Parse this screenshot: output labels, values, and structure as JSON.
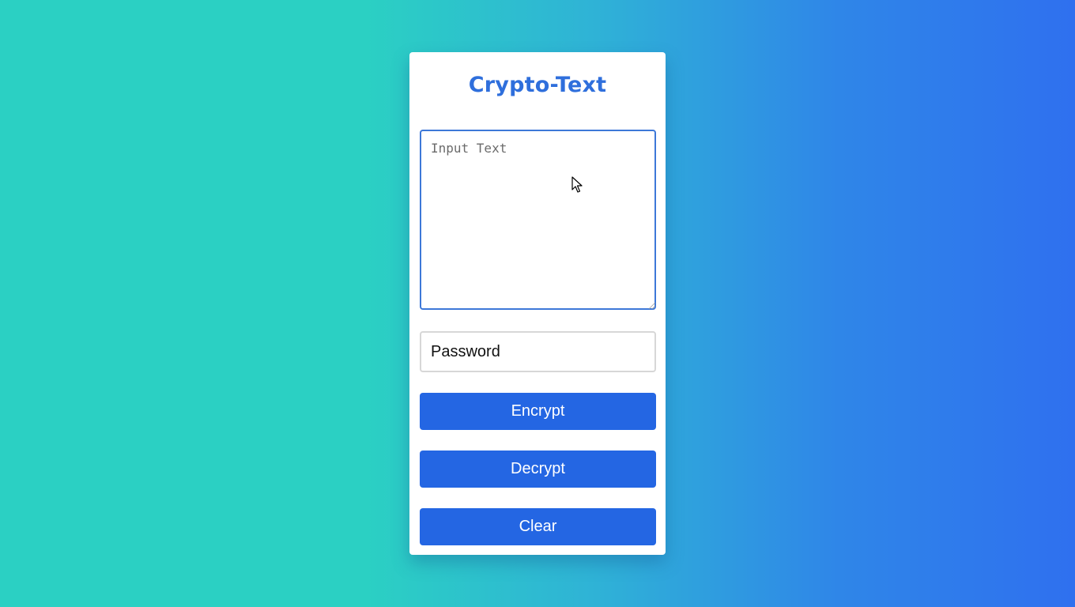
{
  "app": {
    "title": "Crypto-Text"
  },
  "text_input": {
    "placeholder": "Input Text",
    "value": ""
  },
  "password_input": {
    "placeholder": "Password",
    "value": ""
  },
  "buttons": {
    "encrypt": "Encrypt",
    "decrypt": "Decrypt",
    "clear": "Clear"
  },
  "colors": {
    "accent": "#2466e3",
    "title": "#2f6fdc",
    "background_start": "#2bd0c3",
    "background_end": "#2f70ef"
  },
  "icons": {
    "mouse_cursor": "arrow-cursor-icon"
  }
}
